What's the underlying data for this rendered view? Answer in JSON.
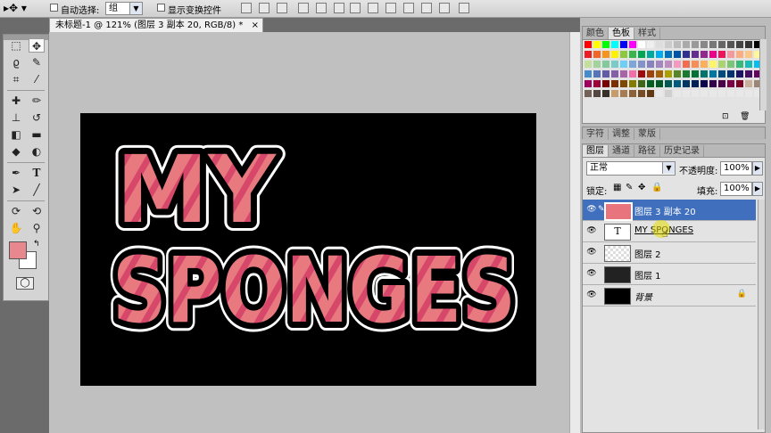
{
  "options_bar": {
    "auto_select_label": "自动选择:",
    "auto_select_value": "组",
    "show_transform_label": "显示变换控件"
  },
  "document": {
    "tab_title": "未标题-1 @ 121% (图层 3 副本 20, RGB/8) *",
    "close_glyph": "×",
    "artwork_line1": "MY",
    "artwork_line2": "SPONGES",
    "artwork_fill": "#e7797f",
    "artwork_stripe": "#d6476a"
  },
  "toolbox": {
    "foreground_color": "#e8888e",
    "background_color": "#ffffff"
  },
  "swatches_panel": {
    "tabs": [
      "颜色",
      "色板",
      "样式"
    ],
    "active_tab": "色板"
  },
  "adjust_panel": {
    "tabs": [
      "字符",
      "调整",
      "蒙版"
    ]
  },
  "layers_panel": {
    "tabs": [
      "图层",
      "通道",
      "路径",
      "历史记录"
    ],
    "blend_mode": "正常",
    "opacity_label": "不透明度:",
    "opacity_value": "100%",
    "lock_label": "锁定:",
    "fill_label": "填充:",
    "fill_value": "100%",
    "layers": [
      {
        "name": "图层 3 副本 20",
        "selected": true
      },
      {
        "name": "MY SPONGES",
        "type": "text"
      },
      {
        "name": "图层 2"
      },
      {
        "name": "图层 1"
      },
      {
        "name": "背景",
        "locked": true
      }
    ]
  }
}
